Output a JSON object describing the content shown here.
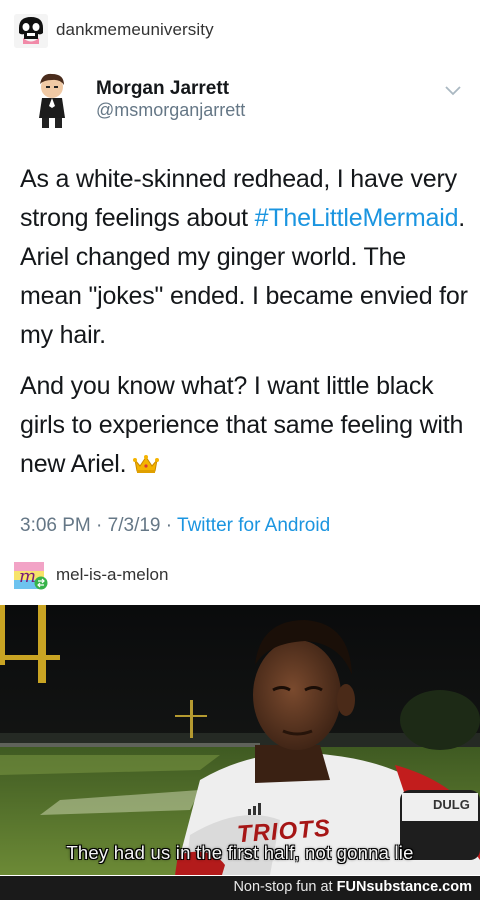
{
  "post": {
    "poster_username": "dankmemeuniversity",
    "reblogger_username": "mel-is-a-melon"
  },
  "tweet": {
    "name": "Morgan Jarrett",
    "handle": "@msmorganjarrett",
    "p1_before": "As a white-skinned redhead, I have very strong feelings about ",
    "hashtag": "#TheLittleMermaid",
    "p1_after": ". Ariel changed my ginger world. The mean \"jokes\" ended. I became envied for my hair.",
    "p2": "And you know what? I want little black girls to experience that same feeling with new Ariel.",
    "time": "3:06 PM",
    "date": "7/3/19",
    "separator": "·",
    "source": "Twitter for Android",
    "crown_icon": "crown-emoji"
  },
  "meme": {
    "caption": "They had us in the first half, not gonna lie",
    "jersey_text": "TRIOTS",
    "mic_text": "DULG"
  },
  "footer": {
    "prefix": "Non-stop fun at",
    "brand": "FUNsubstance.com"
  },
  "colors": {
    "link": "#1b95e0",
    "meta_gray": "#657786",
    "footer_bg": "#1a1a1a"
  }
}
